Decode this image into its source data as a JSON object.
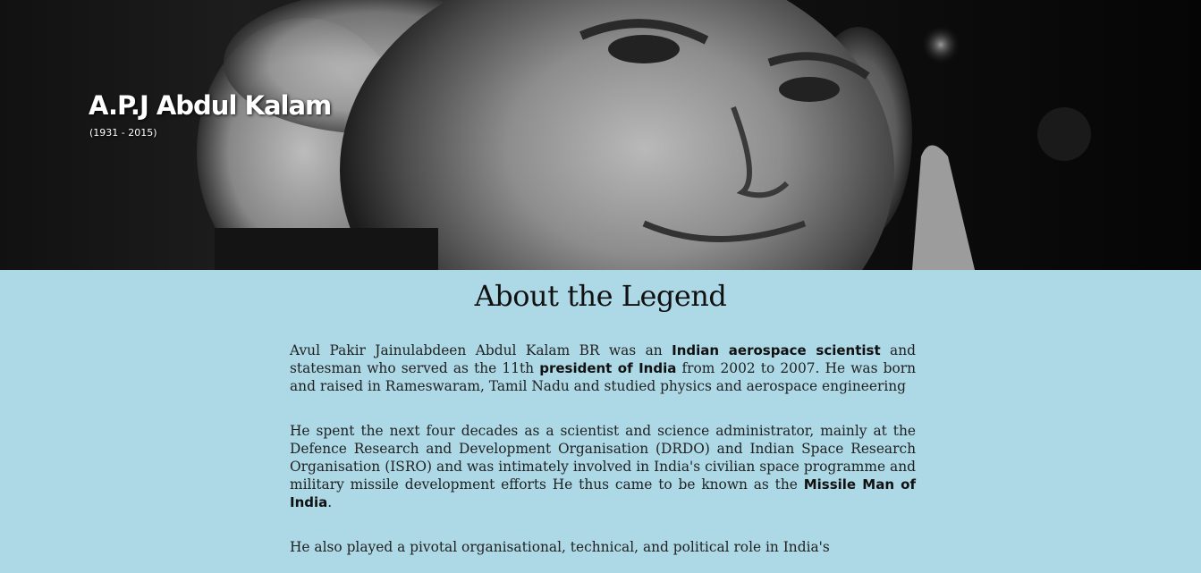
{
  "hero": {
    "title": "A.P.J Abdul Kalam",
    "years": "(1931 - 2015)",
    "image": "black-and-white close-up portrait"
  },
  "about": {
    "heading": "About the Legend",
    "p1": {
      "a": "Avul Pakir Jainulabdeen Abdul Kalam BR was an ",
      "b1": "Indian aerospace scientist",
      "c": " and statesman who served as the 11th ",
      "b2": "president of India",
      "d": " from 2002 to 2007. He was born and raised in Rameswaram, Tamil Nadu and studied physics and aerospace engineering"
    },
    "p2": {
      "a": "He spent the next four decades as a scientist and science administrator, mainly at the Defence Research and Development Organisation (DRDO) and Indian Space Research Organisation (ISRO) and was intimately involved in India's civilian space programme and military missile development efforts He thus came to be known as the ",
      "b1": "Missile Man of India",
      "c": "."
    },
    "p3": {
      "a": "He also played a pivotal organisational, technical, and political role in India's"
    }
  }
}
